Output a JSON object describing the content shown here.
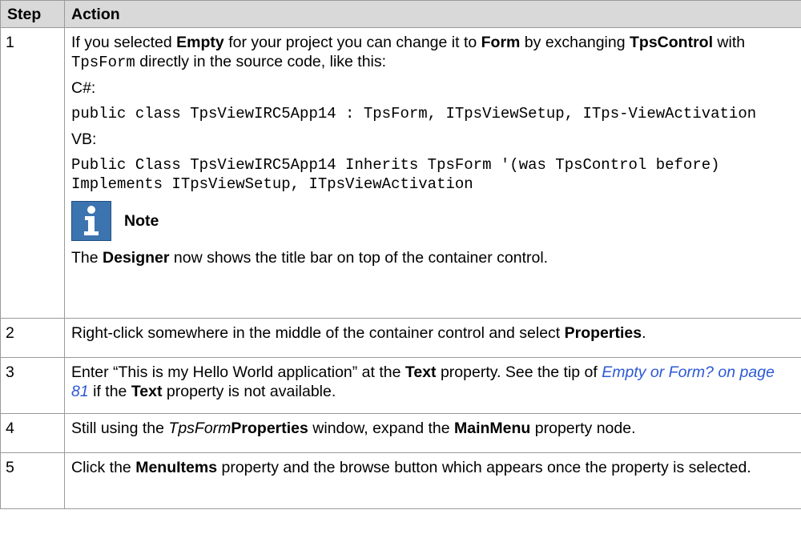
{
  "table": {
    "headers": {
      "step": "Step",
      "action": "Action"
    },
    "rows": [
      {
        "step": "1",
        "intro": {
          "t1": "If you selected ",
          "b1": "Empty",
          "t2": " for your project you can change it to ",
          "b2": "Form",
          "t3": " by exchanging ",
          "b3": "TpsControl",
          "t4": " with ",
          "code": "TpsForm",
          "t5": " directly in the source code, like this:"
        },
        "cs_label": "C#:",
        "cs_code": "public class TpsViewIRC5App14 : TpsForm, ITpsViewSetup, ITps-ViewActivation",
        "vb_label": "VB:",
        "vb_code": "Public Class TpsViewIRC5App14 Inherits TpsForm '(was TpsControl before) Implements ITpsViewSetup, ITpsViewActivation",
        "note_icon": "info-icon",
        "note_label": "Note",
        "note": {
          "t1": "The ",
          "b1": "Designer",
          "t2": " now shows the title bar on top of the container control."
        }
      },
      {
        "step": "2",
        "action": {
          "t1": "Right-click somewhere in the middle of the container control and select ",
          "b1": "Properties",
          "t2": "."
        }
      },
      {
        "step": "3",
        "action": {
          "t1": "Enter “This is my Hello World application” at the ",
          "b1": "Text",
          "t2": " property. See the tip of ",
          "link": "Empty or Form? on page 81",
          "t3": " if the ",
          "b2": "Text",
          "t4": " property is not available."
        }
      },
      {
        "step": "4",
        "action": {
          "t1": "Still using the ",
          "i1": "TpsForm",
          "b1": "Properties",
          "t2": " window, expand the ",
          "b2": "MainMenu",
          "t3": " property node."
        }
      },
      {
        "step": "5",
        "action": {
          "t1": "Click the ",
          "b1": "MenuItems",
          "t2": " property and the browse button which appears once the property is selected."
        }
      }
    ]
  },
  "colors": {
    "header_bg": "#d9d9d9",
    "border": "#9a9a9a",
    "link": "#2c58d6",
    "note_icon_bg": "#3c74b0"
  }
}
